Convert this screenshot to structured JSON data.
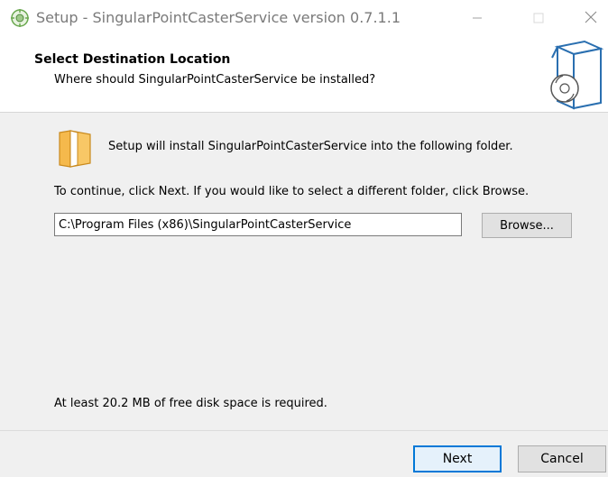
{
  "titlebar": {
    "title": "Setup - SingularPointCasterService version 0.7.1.1",
    "minimize_icon": "minimize-icon",
    "maximize_icon": "maximize-icon",
    "close_icon": "close-icon"
  },
  "header": {
    "title": "Select Destination Location",
    "subtitle": "Where should SingularPointCasterService be installed?"
  },
  "body": {
    "install_text": "Setup will install SingularPointCasterService into the following folder.",
    "continue_text": "To continue, click Next. If you would like to select a different folder, click Browse.",
    "path_value": "C:\\Program Files (x86)\\SingularPointCasterService",
    "browse_label": "Browse...",
    "disk_text": "At least 20.2 MB of free disk space is required."
  },
  "footer": {
    "next_label": "Next",
    "cancel_label": "Cancel"
  },
  "colors": {
    "accent": "#0078d7",
    "folder": "#f5b94c",
    "body_bg": "#f0f0f0"
  }
}
